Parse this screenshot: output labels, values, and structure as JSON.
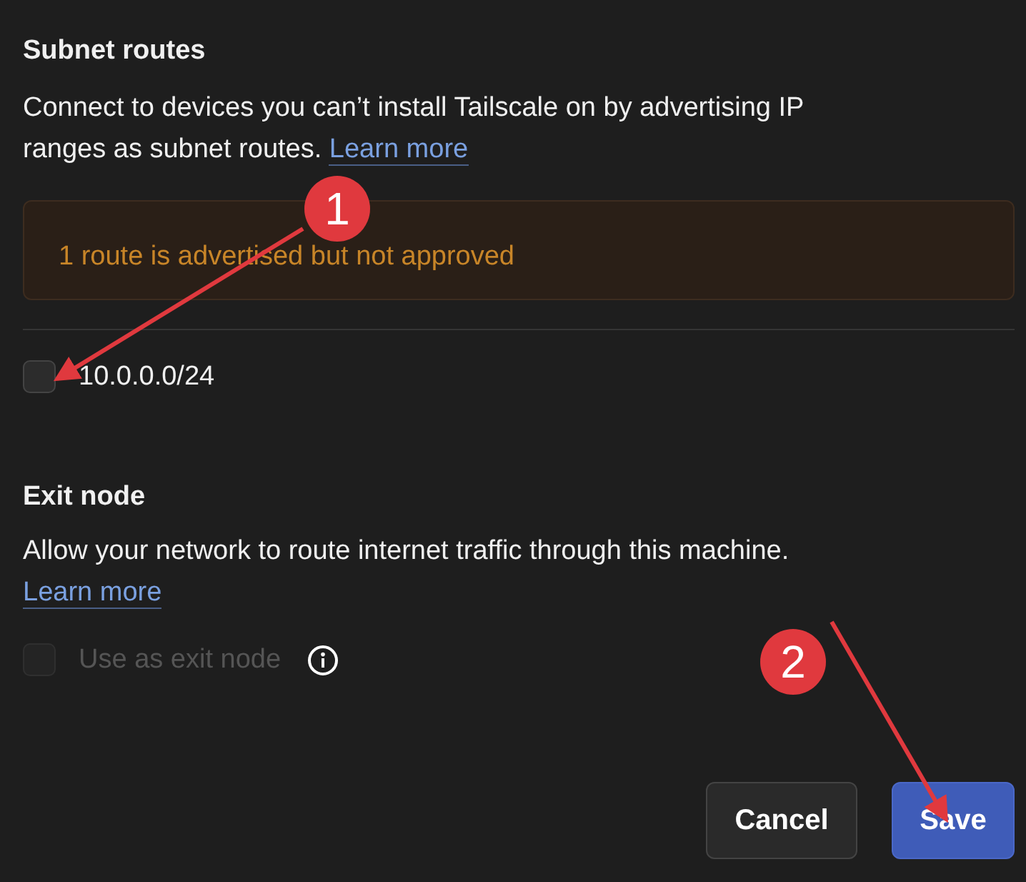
{
  "sections": [
    {
      "title": "Subnet routes",
      "description": "Connect to devices you can’t install Tailscale on by advertising IP ranges as subnet routes.",
      "link": "Learn more",
      "alert": "1 route is advertised but not approved",
      "options": [
        {
          "label": "10.0.0.0/24",
          "checked": false,
          "disabled": false,
          "info": false
        }
      ]
    },
    {
      "title": "Exit node",
      "description": "Allow your network to route internet traffic through this machine.",
      "link": "Learn more",
      "options": [
        {
          "label": "Use as exit node",
          "checked": false,
          "disabled": true,
          "info": true
        }
      ]
    }
  ],
  "buttons": [
    {
      "label": "Cancel",
      "kind": "secondary"
    },
    {
      "label": "Save",
      "kind": "primary"
    }
  ],
  "annotations": [
    {
      "label": "1"
    },
    {
      "label": "2"
    }
  ]
}
